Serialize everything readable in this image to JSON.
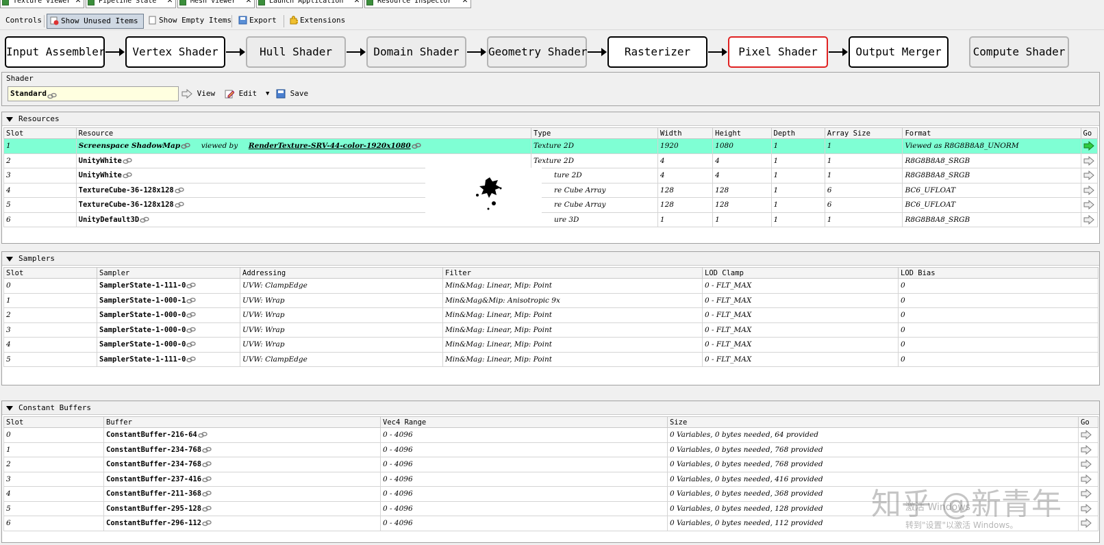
{
  "tabs": [
    {
      "label": "Texture Viewer",
      "close": "✕"
    },
    {
      "label": "Pipeline State",
      "close": "✕"
    },
    {
      "label": "Mesh Viewer",
      "close": "✕"
    },
    {
      "label": "Launch Application",
      "close": "✕"
    },
    {
      "label": "Resource Inspector",
      "close": "✕"
    }
  ],
  "toolbar": {
    "controls_label": "Controls",
    "show_unused": "Show Unused Items",
    "show_empty": "Show Empty Items",
    "export": "Export",
    "extensions": "Extensions"
  },
  "pipeline": {
    "stages": [
      {
        "label": "Input Assembler",
        "state": "enabled"
      },
      {
        "label": "Vertex Shader",
        "state": "enabled"
      },
      {
        "label": "Hull Shader",
        "state": "disabled"
      },
      {
        "label": "Domain Shader",
        "state": "disabled"
      },
      {
        "label": "Geometry Shader",
        "state": "disabled"
      },
      {
        "label": "Rasterizer",
        "state": "enabled"
      },
      {
        "label": "Pixel Shader",
        "state": "active"
      },
      {
        "label": "Output Merger",
        "state": "enabled"
      }
    ],
    "compute": {
      "label": "Compute Shader",
      "state": "disabled"
    }
  },
  "shader": {
    "group_label": "Shader",
    "name": "Standard",
    "view": "View",
    "edit": "Edit",
    "save": "Save"
  },
  "resources": {
    "title": "Resources",
    "columns": [
      "Slot",
      "Resource",
      "Type",
      "Width",
      "Height",
      "Depth",
      "Array Size",
      "Format",
      "Go"
    ],
    "rows": [
      {
        "slot": "1",
        "resource": "Screenspace ShadowMap",
        "viewed_by": "viewed  by",
        "view_name": "RenderTexture-SRV-44-color-1920x1080",
        "type": "Texture 2D",
        "width": "1920",
        "height": "1080",
        "depth": "1",
        "array": "1",
        "format": "Viewed as R8G8B8A8_UNORM",
        "highlight": true
      },
      {
        "slot": "2",
        "resource": "UnityWhite",
        "type": "Texture 2D",
        "width": "4",
        "height": "4",
        "depth": "1",
        "array": "1",
        "format": "R8G8B8A8_SRGB"
      },
      {
        "slot": "3",
        "resource": "UnityWhite",
        "type": "ture 2D",
        "width": "4",
        "height": "4",
        "depth": "1",
        "array": "1",
        "format": "R8G8B8A8_SRGB"
      },
      {
        "slot": "4",
        "resource": "TextureCube-36-128x128",
        "type": "re Cube Array",
        "width": "128",
        "height": "128",
        "depth": "1",
        "array": "6",
        "format": "BC6_UFLOAT"
      },
      {
        "slot": "5",
        "resource": "TextureCube-36-128x128",
        "type": "re Cube Array",
        "width": "128",
        "height": "128",
        "depth": "1",
        "array": "6",
        "format": "BC6_UFLOAT"
      },
      {
        "slot": "6",
        "resource": "UnityDefault3D",
        "type": "ure 3D",
        "width": "1",
        "height": "1",
        "depth": "1",
        "array": "1",
        "format": "R8G8B8A8_SRGB"
      }
    ]
  },
  "samplers": {
    "title": "Samplers",
    "columns": [
      "Slot",
      "Sampler",
      "Addressing",
      "Filter",
      "LOD Clamp",
      "LOD Bias"
    ],
    "rows": [
      {
        "slot": "0",
        "name": "SamplerState-1-111-0",
        "addressing": "UVW: ClampEdge",
        "filter": "Min&Mag: Linear, Mip: Point",
        "lod_clamp": "0 - FLT_MAX",
        "lod_bias": "0"
      },
      {
        "slot": "1",
        "name": "SamplerState-1-000-1",
        "addressing": "UVW: Wrap",
        "filter": "Min&Mag&Mip: Anisotropic 9x",
        "lod_clamp": "0 - FLT_MAX",
        "lod_bias": "0"
      },
      {
        "slot": "2",
        "name": "SamplerState-1-000-0",
        "addressing": "UVW: Wrap",
        "filter": "Min&Mag: Linear, Mip: Point",
        "lod_clamp": "0 - FLT_MAX",
        "lod_bias": "0"
      },
      {
        "slot": "3",
        "name": "SamplerState-1-000-0",
        "addressing": "UVW: Wrap",
        "filter": "Min&Mag: Linear, Mip: Point",
        "lod_clamp": "0 - FLT_MAX",
        "lod_bias": "0"
      },
      {
        "slot": "4",
        "name": "SamplerState-1-000-0",
        "addressing": "UVW: Wrap",
        "filter": "Min&Mag: Linear, Mip: Point",
        "lod_clamp": "0 - FLT_MAX",
        "lod_bias": "0"
      },
      {
        "slot": "5",
        "name": "SamplerState-1-111-0",
        "addressing": "UVW: ClampEdge",
        "filter": "Min&Mag: Linear, Mip: Point",
        "lod_clamp": "0 - FLT_MAX",
        "lod_bias": "0"
      }
    ]
  },
  "constant_buffers": {
    "title": "Constant Buffers",
    "columns": [
      "Slot",
      "Buffer",
      "Vec4 Range",
      "Size",
      "Go"
    ],
    "rows": [
      {
        "slot": "0",
        "name": "ConstantBuffer-216-64",
        "range": "0 - 4096",
        "size": "0 Variables, 0 bytes needed, 64 provided"
      },
      {
        "slot": "1",
        "name": "ConstantBuffer-234-768",
        "range": "0 - 4096",
        "size": "0 Variables, 0 bytes needed, 768 provided"
      },
      {
        "slot": "2",
        "name": "ConstantBuffer-234-768",
        "range": "0 - 4096",
        "size": "0 Variables, 0 bytes needed, 768 provided"
      },
      {
        "slot": "3",
        "name": "ConstantBuffer-237-416",
        "range": "0 - 4096",
        "size": "0 Variables, 0 bytes needed, 416 provided"
      },
      {
        "slot": "4",
        "name": "ConstantBuffer-211-368",
        "range": "0 - 4096",
        "size": "0 Variables, 0 bytes needed, 368 provided"
      },
      {
        "slot": "5",
        "name": "ConstantBuffer-295-128",
        "range": "0 - 4096",
        "size": "0 Variables, 0 bytes needed, 128 provided"
      },
      {
        "slot": "6",
        "name": "ConstantBuffer-296-112",
        "range": "0 - 4096",
        "size": "0 Variables, 0 bytes needed, 112 provided"
      }
    ]
  },
  "watermark": {
    "brand": "知乎 @新青年",
    "activate_title": "激活 Windows",
    "activate_hint": "转到\"设置\"以激活 Windows。"
  },
  "colors": {
    "highlight_row": "#7fffd4",
    "active_stage_border": "#e02020",
    "disabled_stage_border": "#b4b4b4",
    "shader_field_bg": "#ffffe0"
  }
}
